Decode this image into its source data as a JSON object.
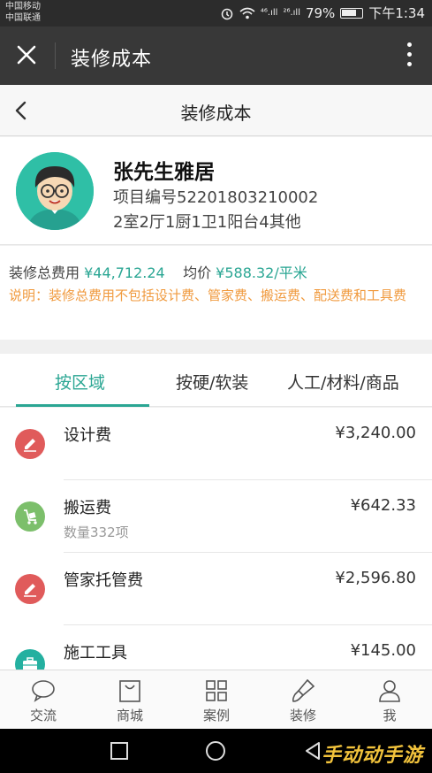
{
  "status_bar": {
    "carrier1": "中国移动",
    "carrier2": "中国联通",
    "signal1": "⁴⁶.ıll",
    "signal2": "²⁶.ıll",
    "battery": "79%",
    "time": "下午1:34"
  },
  "wechat_bar": {
    "title": "装修成本"
  },
  "page_header": {
    "title": "装修成本"
  },
  "profile": {
    "name": "张先生雅居",
    "project_code": "项目编号52201803210002",
    "layout": "2室2厅1厨1卫1阳台4其他"
  },
  "summary": {
    "total_label": "装修总费用",
    "total_value": "¥44,712.24",
    "avg_label": "均价",
    "avg_value": "¥588.32/平米",
    "note": "说明：装修总费用不包括设计费、管家费、搬运费、配送费和工具费"
  },
  "tabs": [
    {
      "label": "按区域",
      "active": true
    },
    {
      "label": "按硬/软装",
      "active": false
    },
    {
      "label": "人工/材料/商品",
      "active": false
    }
  ],
  "items": [
    {
      "label": "设计费",
      "amount": "¥3,240.00",
      "sub": "",
      "icon": "pencil-icon",
      "color": "#e05b5b"
    },
    {
      "label": "搬运费",
      "amount": "¥642.33",
      "sub": "数量332项",
      "icon": "cart-icon",
      "color": "#7cbf6b"
    },
    {
      "label": "管家托管费",
      "amount": "¥2,596.80",
      "sub": "",
      "icon": "pencil-icon",
      "color": "#e05b5b"
    },
    {
      "label": "施工工具",
      "amount": "¥145.00",
      "sub": "",
      "icon": "toolbox-icon",
      "color": "#24b0a0"
    }
  ],
  "bottom_nav": [
    {
      "label": "交流",
      "icon": "chat-icon"
    },
    {
      "label": "商城",
      "icon": "shopping-bag-icon"
    },
    {
      "label": "案例",
      "icon": "grid-icon"
    },
    {
      "label": "装修",
      "icon": "brush-icon"
    },
    {
      "label": "我",
      "icon": "person-icon"
    }
  ],
  "watermark": "手动动手游",
  "colors": {
    "accent": "#2aa693",
    "note": "#f09a3e",
    "title_bar": "#383838"
  }
}
